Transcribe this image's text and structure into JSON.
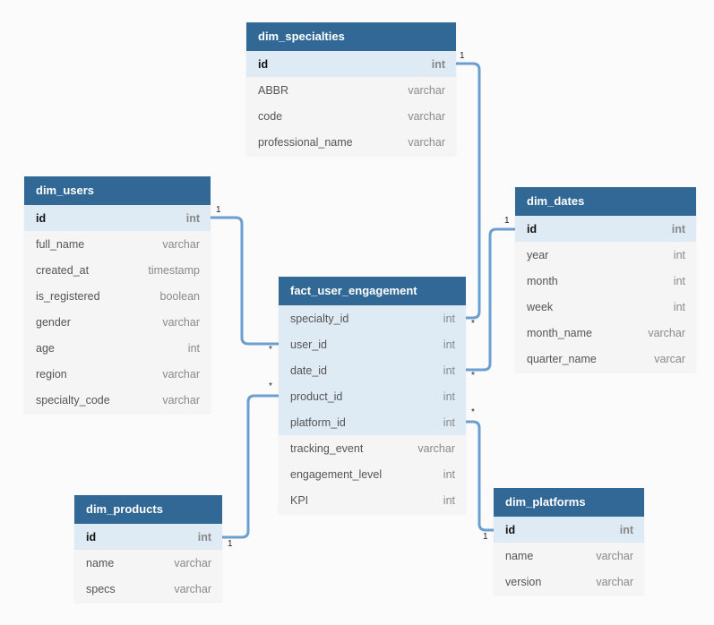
{
  "colors": {
    "background": "#fbfbfb",
    "header": "#316896",
    "header_text": "#ffffff",
    "key_row": "#deeaf4",
    "row": "#f5f5f5",
    "relation_line": "#6a9fcf"
  },
  "tables": {
    "dim_specialties": {
      "name": "dim_specialties",
      "fields": [
        {
          "name": "id",
          "type": "int",
          "key": "pk"
        },
        {
          "name": "ABBR",
          "type": "varchar"
        },
        {
          "name": "code",
          "type": "varchar"
        },
        {
          "name": "professional_name",
          "type": "varchar"
        }
      ]
    },
    "dim_users": {
      "name": "dim_users",
      "fields": [
        {
          "name": "id",
          "type": "int",
          "key": "pk"
        },
        {
          "name": "full_name",
          "type": "varchar"
        },
        {
          "name": "created_at",
          "type": "timestamp"
        },
        {
          "name": "is_registered",
          "type": "boolean"
        },
        {
          "name": "gender",
          "type": "varchar"
        },
        {
          "name": "age",
          "type": "int"
        },
        {
          "name": "region",
          "type": "varchar"
        },
        {
          "name": "specialty_code",
          "type": "varchar"
        }
      ]
    },
    "fact_user_engagement": {
      "name": "fact_user_engagement",
      "fields": [
        {
          "name": "specialty_id",
          "type": "int",
          "key": "fk"
        },
        {
          "name": "user_id",
          "type": "int",
          "key": "fk"
        },
        {
          "name": "date_id",
          "type": "int",
          "key": "fk"
        },
        {
          "name": "product_id",
          "type": "int",
          "key": "fk"
        },
        {
          "name": "platform_id",
          "type": "int",
          "key": "fk"
        },
        {
          "name": "tracking_event",
          "type": "varchar"
        },
        {
          "name": "engagement_level",
          "type": "int"
        },
        {
          "name": "KPI",
          "type": "int"
        }
      ]
    },
    "dim_dates": {
      "name": "dim_dates",
      "fields": [
        {
          "name": "id",
          "type": "int",
          "key": "pk"
        },
        {
          "name": "year",
          "type": "int"
        },
        {
          "name": "month",
          "type": "int"
        },
        {
          "name": "week",
          "type": "int"
        },
        {
          "name": "month_name",
          "type": "varchar"
        },
        {
          "name": "quarter_name",
          "type": "varcar"
        }
      ]
    },
    "dim_products": {
      "name": "dim_products",
      "fields": [
        {
          "name": "id",
          "type": "int",
          "key": "pk"
        },
        {
          "name": "name",
          "type": "varchar"
        },
        {
          "name": "specs",
          "type": "varchar"
        }
      ]
    },
    "dim_platforms": {
      "name": "dim_platforms",
      "fields": [
        {
          "name": "id",
          "type": "int",
          "key": "pk"
        },
        {
          "name": "name",
          "type": "varchar"
        },
        {
          "name": "version",
          "type": "varchar"
        }
      ]
    }
  },
  "relations": [
    {
      "from": "dim_specialties.id",
      "to": "fact_user_engagement.specialty_id",
      "from_card": "1",
      "to_card": "*"
    },
    {
      "from": "dim_users.id",
      "to": "fact_user_engagement.user_id",
      "from_card": "1",
      "to_card": "*"
    },
    {
      "from": "dim_dates.id",
      "to": "fact_user_engagement.date_id",
      "from_card": "1",
      "to_card": "*"
    },
    {
      "from": "dim_products.id",
      "to": "fact_user_engagement.product_id",
      "from_card": "1",
      "to_card": "*"
    },
    {
      "from": "dim_platforms.id",
      "to": "fact_user_engagement.platform_id",
      "from_card": "1",
      "to_card": "*"
    }
  ]
}
